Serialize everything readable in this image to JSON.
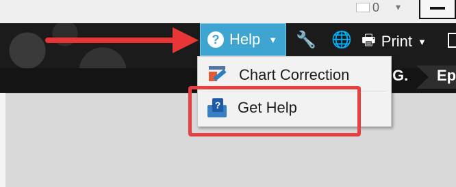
{
  "top": {
    "counter": "0",
    "caret": "▾"
  },
  "toolbar": {
    "help_label": "Help",
    "help_icon": "question-circle-icon",
    "print_label": "Print",
    "settings_icon": "wrench-icon",
    "globe_icon": "globe-icon",
    "print_icon": "printer-icon"
  },
  "lower_toolbar": {
    "left_text": "G.",
    "right_text": "Ep"
  },
  "help_menu": {
    "items": [
      {
        "label": "Chart Correction",
        "icon": "chart-edit-icon"
      },
      {
        "label": "Get Help",
        "icon": "help-box-icon"
      }
    ]
  },
  "colors": {
    "accent": "#3ea4d1",
    "annotation": "#e83636"
  }
}
